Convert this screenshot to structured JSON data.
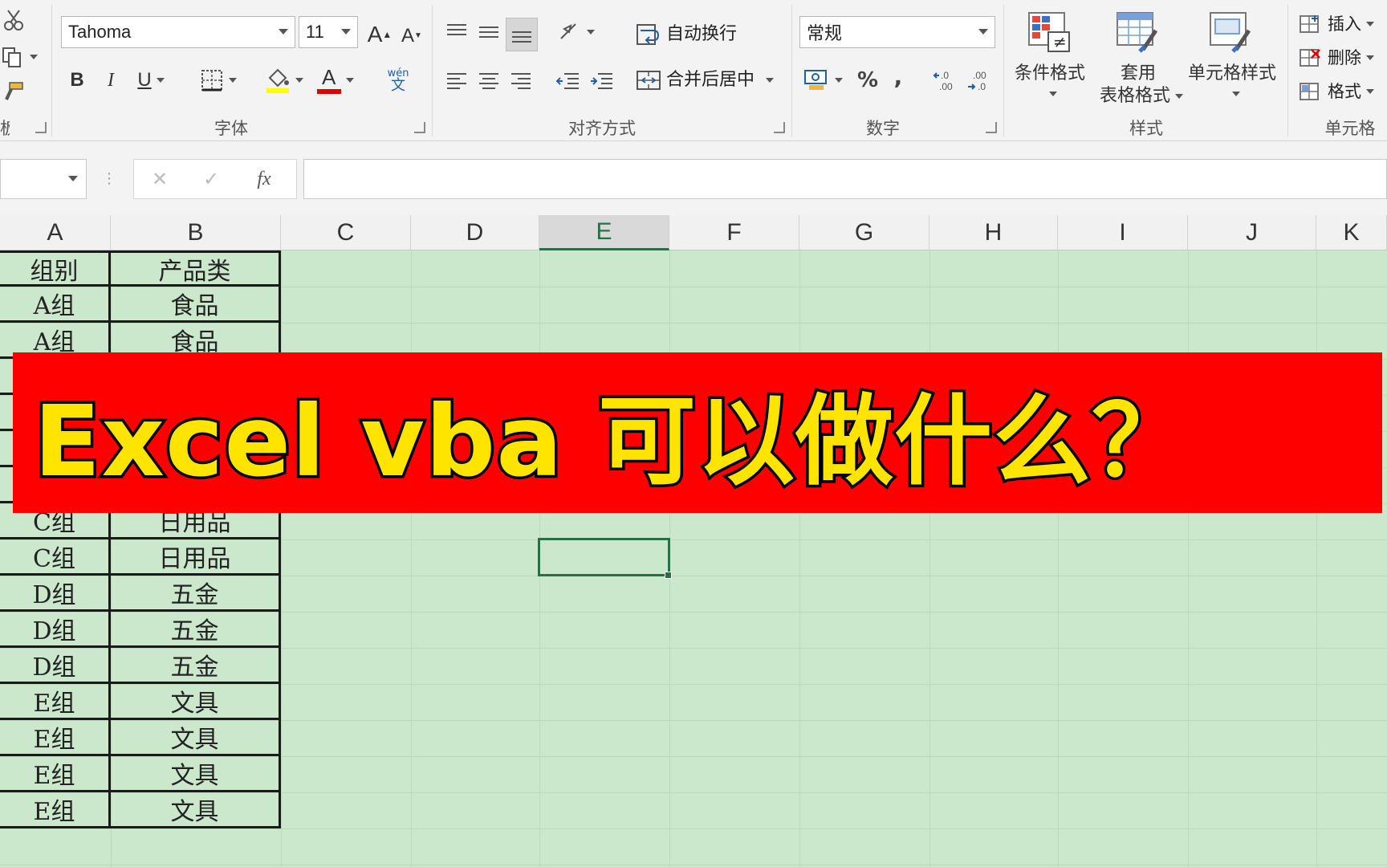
{
  "ribbon": {
    "font_group": {
      "font_name": "Tahoma",
      "font_size": "11",
      "label": "字体",
      "bold": "B",
      "italic": "I",
      "underline": "U",
      "grow_font": "A",
      "shrink_font": "A",
      "font_color": "A",
      "phonetic": "wén"
    },
    "align_group": {
      "wrap_text": "自动换行",
      "merge_center": "合并后居中",
      "label": "对齐方式"
    },
    "number_group": {
      "format": "常规",
      "percent": "%",
      "comma": ",",
      "label": "数字"
    },
    "styles_group": {
      "conditional_format": "条件格式",
      "format_as_table_line1": "套用",
      "format_as_table_line2": "表格格式",
      "cell_styles": "单元格样式",
      "label": "样式"
    },
    "cells_group": {
      "insert": "插入",
      "delete": "删除",
      "format": "格式",
      "label": "单元格"
    },
    "clipboard_group": {
      "label_partial": "板"
    }
  },
  "formula_bar": {
    "fx": "fx",
    "cancel": "✕",
    "enter": "✓"
  },
  "sheet": {
    "columns": [
      "A",
      "B",
      "C",
      "D",
      "E",
      "F",
      "G",
      "H",
      "I",
      "J",
      "K"
    ],
    "selected_column": "E",
    "rows": [
      [
        "组别",
        "产品类"
      ],
      [
        "A组",
        "食品"
      ],
      [
        "A组",
        "食品"
      ],
      [
        "",
        ""
      ],
      [
        "",
        ""
      ],
      [
        "",
        ""
      ],
      [
        "",
        ""
      ],
      [
        "C组",
        "日用品"
      ],
      [
        "C组",
        "日用品"
      ],
      [
        "D组",
        "五金"
      ],
      [
        "D组",
        "五金"
      ],
      [
        "D组",
        "五金"
      ],
      [
        "E组",
        "文具"
      ],
      [
        "E组",
        "文具"
      ],
      [
        "E组",
        "文具"
      ],
      [
        "E组",
        "文具"
      ]
    ]
  },
  "banner": {
    "text": "Excel vba 可以做什么？"
  },
  "colors": {
    "sheet_bg": "#cbe8cc",
    "banner_bg": "#ff0000",
    "banner_text": "#ffe400",
    "accent": "#217346"
  }
}
